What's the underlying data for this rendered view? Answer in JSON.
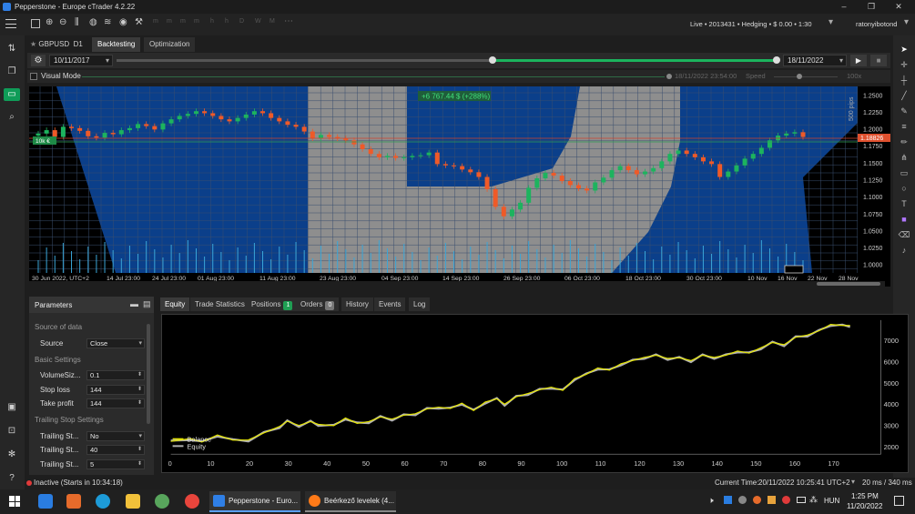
{
  "window": {
    "title": "Pepperstone - Europe cTrader 4.2.22",
    "minimize": "–",
    "restore": "❐",
    "close": "✕"
  },
  "header": {
    "status_text": "Live • 2013431 • Hedging • $ 0.00 • 1:30",
    "user": "ratonyibotond",
    "tool_letters": [
      "h",
      "D",
      "W",
      "M"
    ]
  },
  "tabs": {
    "symbol": "GBPUSD",
    "timeframe": "D1",
    "backtesting": "Backtesting",
    "optimization": "Optimization"
  },
  "daterange": {
    "start": "10/11/2017",
    "end": "18/11/2022",
    "visual_mode": "Visual Mode",
    "current_time": "18/11/2022 23:54:00",
    "speed_label": "Speed",
    "speed_value": "100x"
  },
  "chart_data": {
    "type": "candlestick",
    "symbol": "GBPUSD",
    "profit_label": "+6 767.44 $ (+288%)",
    "position_label": "10k €",
    "current_price": "1.18826",
    "scale_label": "500 pips",
    "time_zone": "UTC+2",
    "x_labels": [
      "30 Jun 2022, UTC+2",
      "14 Jul 23:00",
      "24 Jul 23:00",
      "01 Aug 23:00",
      "11 Aug 23:00",
      "23 Aug 23:00",
      "04 Sep 23:00",
      "14 Sep 23:00",
      "26 Sep 23:00",
      "06 Oct 23:00",
      "18 Oct 23:00",
      "30 Oct 23:00",
      "10 Nov",
      "16 Nov",
      "22 Nov",
      "28 Nov"
    ],
    "y_ticks": [
      "1.2500",
      "1.2250",
      "1.2000",
      "1.1750",
      "1.1500",
      "1.1250",
      "1.1000",
      "1.0750",
      "1.0500",
      "1.0250",
      "1.0000"
    ],
    "ylim": [
      0.9875,
      1.2625
    ],
    "closes": [
      1.193,
      1.198,
      1.188,
      1.203,
      1.201,
      1.197,
      1.189,
      1.187,
      1.194,
      1.192,
      1.198,
      1.201,
      1.207,
      1.204,
      1.199,
      1.208,
      1.214,
      1.219,
      1.222,
      1.226,
      1.223,
      1.219,
      1.214,
      1.211,
      1.216,
      1.221,
      1.226,
      1.223,
      1.216,
      1.211,
      1.206,
      1.203,
      1.196,
      1.186,
      1.191,
      1.188,
      1.186,
      1.183,
      1.177,
      1.17,
      1.163,
      1.158,
      1.16,
      1.157,
      1.158,
      1.16,
      1.161,
      1.165,
      1.148,
      1.146,
      1.145,
      1.14,
      1.136,
      1.129,
      1.111,
      1.085,
      1.071,
      1.081,
      1.091,
      1.113,
      1.127,
      1.135,
      1.131,
      1.123,
      1.117,
      1.112,
      1.109,
      1.121,
      1.128,
      1.139,
      1.145,
      1.139,
      1.133,
      1.137,
      1.142,
      1.152,
      1.163,
      1.168,
      1.163,
      1.158,
      1.152,
      1.148,
      1.129,
      1.137,
      1.146,
      1.156,
      1.163,
      1.172,
      1.183,
      1.19,
      1.193,
      1.195,
      1.188
    ],
    "volume_note": "volume bars",
    "background_logo": "Pepperstone"
  },
  "params": {
    "title": "Parameters",
    "source_section": "Source of data",
    "source_label": "Source",
    "source_value": "Close",
    "basic_section": "Basic Settings",
    "volume_label": "VolumeSiz...",
    "volume_value": "0.1",
    "stoploss_label": "Stop loss",
    "stoploss_value": "144",
    "takeprofit_label": "Take profit",
    "takeprofit_value": "144",
    "trailing_section": "Trailing Stop Settings",
    "trailing1_label": "Trailing St...",
    "trailing1_value": "No",
    "trailing2_label": "Trailing St...",
    "trailing2_value": "40",
    "trailing3_label": "Trailing St...",
    "trailing3_value": "5"
  },
  "bottom_tabs": {
    "equity": "Equity",
    "trade_stats": "Trade Statistics",
    "positions": "Positions",
    "positions_count": "1",
    "orders": "Orders",
    "orders_count": "0",
    "history": "History",
    "events": "Events",
    "log": "Log"
  },
  "equity_chart": {
    "type": "line",
    "x_ticks": [
      0,
      10,
      20,
      30,
      40,
      50,
      60,
      70,
      80,
      90,
      100,
      110,
      120,
      130,
      140,
      150,
      160,
      170
    ],
    "y_ticks": [
      2000,
      3000,
      4000,
      5000,
      6000,
      7000
    ],
    "xlim": [
      0,
      176
    ],
    "ylim": [
      1650,
      7950
    ],
    "legend": [
      "Balance",
      "Equity"
    ],
    "series_colors": {
      "balance": "#e6e600",
      "equity": "#b0b0b0"
    },
    "points": [
      [
        0,
        2250
      ],
      [
        5,
        2380
      ],
      [
        8,
        2220
      ],
      [
        12,
        2550
      ],
      [
        16,
        2310
      ],
      [
        20,
        2320
      ],
      [
        24,
        2650
      ],
      [
        28,
        2950
      ],
      [
        30,
        3200
      ],
      [
        33,
        3000
      ],
      [
        36,
        3180
      ],
      [
        38,
        3050
      ],
      [
        42,
        2990
      ],
      [
        45,
        3350
      ],
      [
        48,
        3100
      ],
      [
        51,
        3180
      ],
      [
        54,
        3400
      ],
      [
        57,
        3300
      ],
      [
        60,
        3480
      ],
      [
        63,
        3550
      ],
      [
        66,
        3780
      ],
      [
        69,
        3860
      ],
      [
        72,
        3800
      ],
      [
        75,
        4050
      ],
      [
        78,
        3700
      ],
      [
        81,
        4100
      ],
      [
        84,
        4250
      ],
      [
        86,
        4000
      ],
      [
        89,
        4350
      ],
      [
        92,
        4500
      ],
      [
        95,
        4680
      ],
      [
        98,
        4800
      ],
      [
        101,
        4650
      ],
      [
        104,
        5200
      ],
      [
        107,
        5400
      ],
      [
        110,
        5700
      ],
      [
        113,
        5600
      ],
      [
        116,
        5900
      ],
      [
        119,
        6050
      ],
      [
        122,
        6200
      ],
      [
        125,
        6300
      ],
      [
        128,
        6150
      ],
      [
        131,
        6180
      ],
      [
        134,
        6050
      ],
      [
        137,
        6300
      ],
      [
        140,
        6200
      ],
      [
        143,
        6300
      ],
      [
        146,
        6500
      ],
      [
        149,
        6400
      ],
      [
        152,
        6650
      ],
      [
        155,
        6900
      ],
      [
        158,
        6800
      ],
      [
        161,
        7150
      ],
      [
        164,
        7250
      ],
      [
        167,
        7450
      ],
      [
        170,
        7750
      ],
      [
        173,
        7700
      ],
      [
        175,
        7700
      ]
    ]
  },
  "status": {
    "state": "Inactive (Starts in 10:34:18)",
    "current_time_label": "Current Time:",
    "current_time": "20/11/2022 10:25:41",
    "timezone": "UTC+2",
    "latency": "20 ms / 340 ms"
  },
  "taskbar": {
    "app1": "Pepperstone - Euro...",
    "app2": "Beérkező levelek (4...",
    "lang": "HUN",
    "time": "1:25 PM",
    "date": "11/20/2022"
  }
}
